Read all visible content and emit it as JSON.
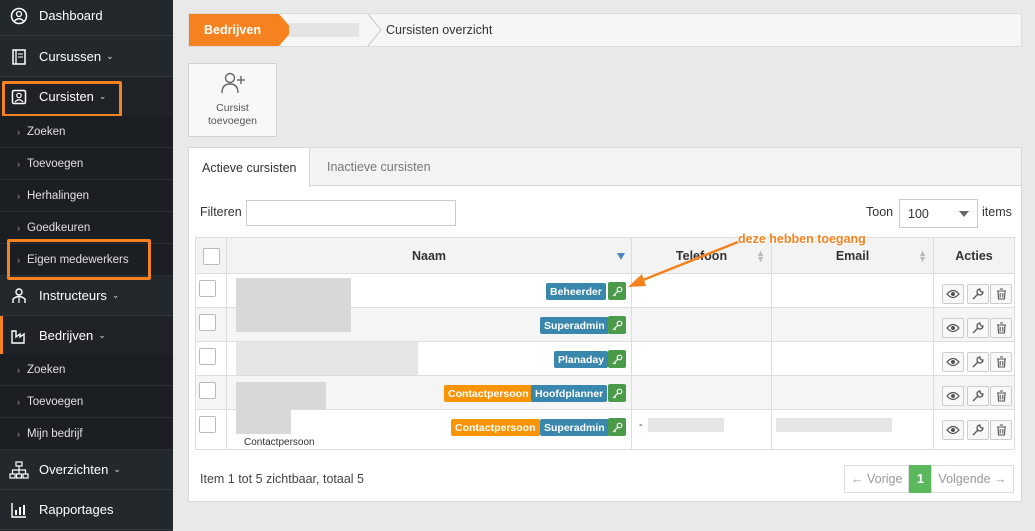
{
  "sidebar": {
    "items": [
      {
        "label": "Dashboard",
        "icon": "dashboard-icon"
      },
      {
        "label": "Cursussen",
        "icon": "book-icon",
        "caret": "⌄"
      },
      {
        "label": "Cursisten",
        "icon": "user-card-icon",
        "caret": "⌄"
      },
      {
        "label": "Instructeurs",
        "icon": "instructor-icon",
        "caret": "⌄"
      },
      {
        "label": "Bedrijven",
        "icon": "factory-icon",
        "caret": "⌄"
      },
      {
        "label": "Overzichten",
        "icon": "hierarchy-icon",
        "caret": "⌄"
      },
      {
        "label": "Rapportages",
        "icon": "bar-chart-icon"
      }
    ],
    "cursisten_sub": [
      "Zoeken",
      "Toevoegen",
      "Herhalingen",
      "Goedkeuren",
      "Eigen medewerkers"
    ],
    "bedrijven_sub": [
      "Zoeken",
      "Toevoegen",
      "Mijn bedrijf"
    ]
  },
  "breadcrumb": {
    "active": "Bedrijven",
    "current": "Cursisten overzicht"
  },
  "add_button": {
    "line1": "Cursist",
    "line2": "toevoegen"
  },
  "tabs": [
    "Actieve cursisten",
    "Inactieve cursisten"
  ],
  "filter": {
    "label": "Filteren",
    "value": ""
  },
  "page_size": {
    "label": "Toon",
    "value": "100",
    "suffix": "items"
  },
  "table": {
    "columns": [
      "Naam",
      "Telefoon",
      "Email",
      "Acties"
    ],
    "rows": [
      {
        "badges": [
          {
            "text": "Beheerder",
            "color": "blue"
          }
        ]
      },
      {
        "badges": [
          {
            "text": "Superadmin",
            "color": "blue"
          }
        ]
      },
      {
        "badges": [
          {
            "text": "Planaday",
            "color": "blue"
          }
        ]
      },
      {
        "badges": [
          {
            "text": "Contactpersoon",
            "color": "orange"
          },
          {
            "text": "Hoofdplanner",
            "color": "blue"
          }
        ]
      },
      {
        "badges": [
          {
            "text": "Contactpersoon",
            "color": "orange"
          },
          {
            "text": "Superadmin",
            "color": "blue"
          }
        ],
        "sub": "Contactpersoon",
        "phone_prefix": "-"
      }
    ]
  },
  "footer": {
    "info": "Item 1 tot 5 zichtbaar, totaal 5",
    "prev": "← Vorige",
    "page": "1",
    "next": "Volgende →"
  },
  "annotation": "deze hebben toegang",
  "colors": {
    "accent": "#f5821f",
    "sidebar_bg": "#23282d",
    "badge_blue": "#3a87ad",
    "badge_orange": "#f89406",
    "key_green": "#4a9a4a"
  }
}
